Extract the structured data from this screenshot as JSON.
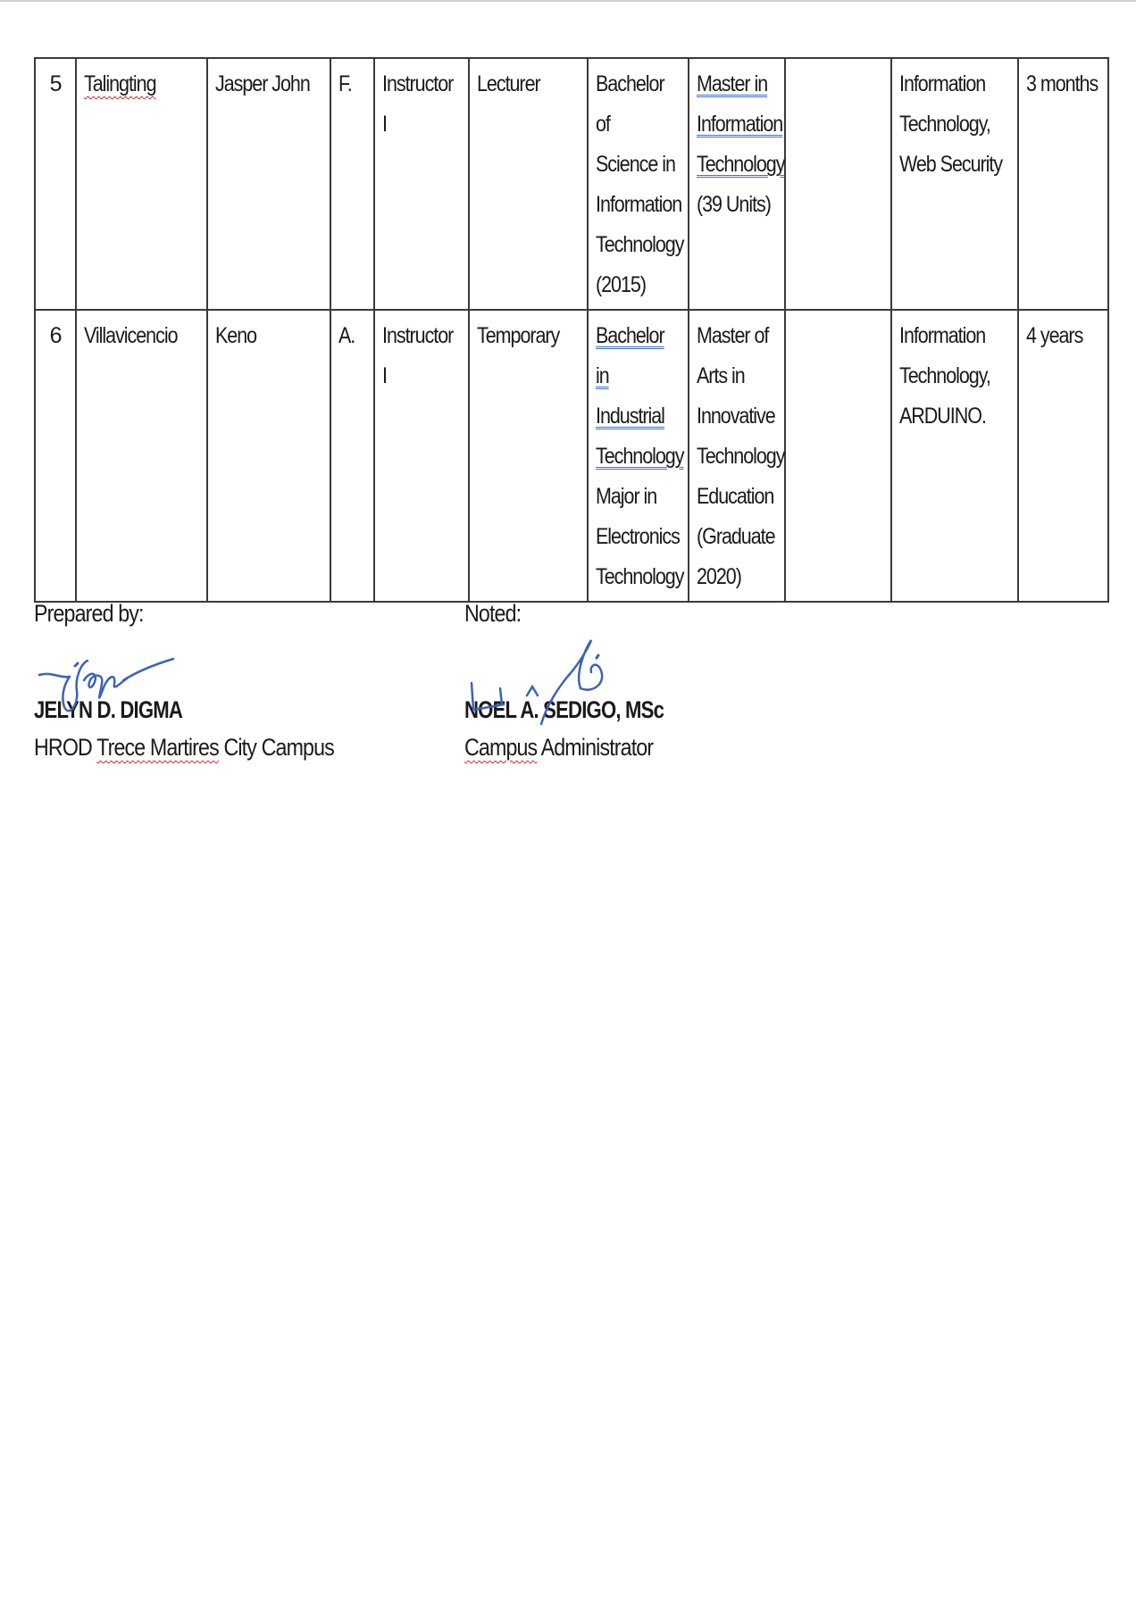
{
  "table": {
    "rows": [
      {
        "no": "5",
        "surname": "Talingting",
        "first_name": "Jasper John",
        "middle_initial": "F.",
        "rank": "Instructor I",
        "status": "Lecturer",
        "bachelor": [
          "Bachelor of",
          "Science in",
          "Information",
          "Technology",
          "(2015)"
        ],
        "master": [
          "Master in",
          "Information",
          "Technology",
          "(39 Units)"
        ],
        "doctorate": "",
        "specialization": [
          "Information",
          "Technology,",
          "Web Security"
        ],
        "years": "3 months"
      },
      {
        "no": "6",
        "surname": "Villavicencio",
        "first_name": "Keno",
        "middle_initial": "A.",
        "rank": "Instructor I",
        "status": "Temporary",
        "bachelor": [
          "Bachelor in",
          "Industrial",
          "Technology",
          "Major in",
          "Electronics",
          "Technology"
        ],
        "master": [
          "Master of",
          "Arts in",
          "Innovative",
          "Technology",
          "Education",
          "(Graduate",
          "2020)"
        ],
        "doctorate": "",
        "specialization": [
          "Information",
          "Technology,",
          "ARDUINO."
        ],
        "years": "4 years"
      }
    ]
  },
  "signatures": {
    "prepared": {
      "label": "Prepared by:",
      "name": "JELYN D. DIGMA",
      "role_prefix": "HROD",
      "role_underlined": "Trece Martires",
      "role_suffix": "City Campus"
    },
    "noted": {
      "label": "Noted:",
      "name": "NOEL A. SEDIGO, MSc",
      "role_underlined": "Campus",
      "role_suffix": "Administrator"
    }
  },
  "colors": {
    "signature_ink": "#3b63b8",
    "spell_underline": "#cc2222",
    "grammar_underline": "#3b6fd4"
  }
}
